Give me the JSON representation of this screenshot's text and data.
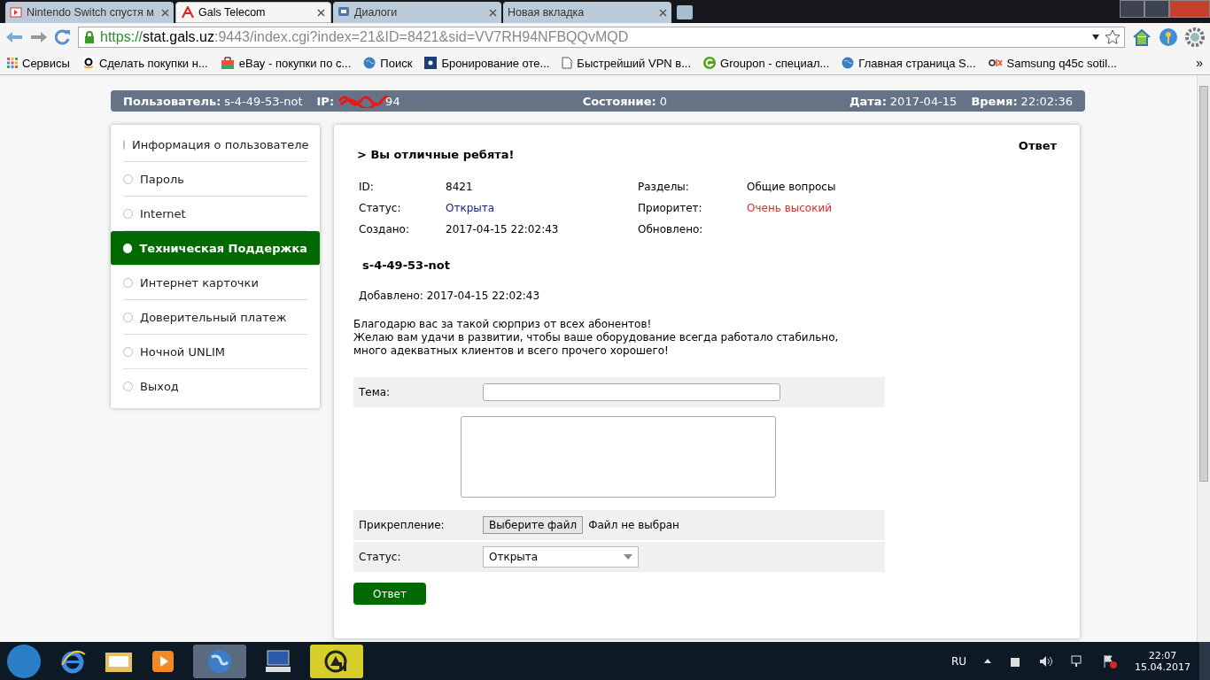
{
  "browser": {
    "tabs": [
      {
        "title": "Nintendo Switch спустя м",
        "selected": false
      },
      {
        "title": "Gals Telecom",
        "selected": true
      },
      {
        "title": "Диалоги",
        "selected": false
      },
      {
        "title": "Новая вкладка",
        "selected": false
      }
    ],
    "url": {
      "scheme": "https://",
      "host": "stat.gals.uz",
      "rest": ":9443/index.cgi?index=21&ID=8421&sid=VV7RH94NFBQQvMQD"
    },
    "bookmarks": [
      {
        "label": "Сервисы"
      },
      {
        "label": "Сделать покупки н..."
      },
      {
        "label": "eBay - покупки по с..."
      },
      {
        "label": "Поиск"
      },
      {
        "label": "Бронирование оте..."
      },
      {
        "label": "Быстрейший VPN в..."
      },
      {
        "label": "Groupon - специал..."
      },
      {
        "label": "Главная страница S..."
      },
      {
        "label": "Samsung q45c sotil..."
      }
    ],
    "more": "»"
  },
  "header": {
    "user_label": "Пользователь:",
    "user": "s-4-49-53-not",
    "ip_label": "IP:",
    "ip": "94",
    "state_label": "Состояние:",
    "state": "0",
    "date_label": "Дата:",
    "date": "2017-04-15",
    "time_label": "Время:",
    "time": "22:02:36"
  },
  "menu": [
    {
      "label": "Информация о пользователе",
      "selected": false
    },
    {
      "label": "Пароль",
      "selected": false
    },
    {
      "label": "Internet",
      "selected": false
    },
    {
      "label": "Техническая Поддержка",
      "selected": true
    },
    {
      "label": "Интернет карточки",
      "selected": false
    },
    {
      "label": "Доверительный платеж",
      "selected": false
    },
    {
      "label": "Ночной UNLIM",
      "selected": false
    },
    {
      "label": "Выход",
      "selected": false
    }
  ],
  "ticket": {
    "title": "> Вы отличные ребята!",
    "reply_link": "Ответ",
    "fields": [
      {
        "label": "ID:",
        "value": "8421",
        "kind": "plain"
      },
      {
        "label": "Разделы:",
        "value": "Общие вопросы",
        "kind": "plain"
      },
      {
        "label": "Статус:",
        "value": "Открыта",
        "kind": "status"
      },
      {
        "label": "Приоритет:",
        "value": "Очень высокий",
        "kind": "alert"
      },
      {
        "label": "Создано:",
        "value": "2017-04-15 22:02:43",
        "kind": "plain"
      },
      {
        "label": "Обновлено:"
      }
    ],
    "author": "s-4-49-53-not",
    "added": "Добавлено: 2017-04-15 22:02:43",
    "message": [
      "Благодарю вас за такой сюрприз от всех абонентов!",
      "Желаю вам удачи в развитии, чтобы ваше оборудование всегда работало стабильно, много адекватных клиентов и всего прочего хорошего!"
    ]
  },
  "form": {
    "subject_label": "Тема:",
    "attach_label": "Прикрепление:",
    "file_button": "Выберите файл",
    "file_status": "Файл не выбран",
    "status_label": "Статус:",
    "status_value": "Открыта",
    "submit": "Ответ"
  },
  "taskbar": {
    "lang": "RU",
    "time": "22:07",
    "date": "15.04.2017"
  }
}
